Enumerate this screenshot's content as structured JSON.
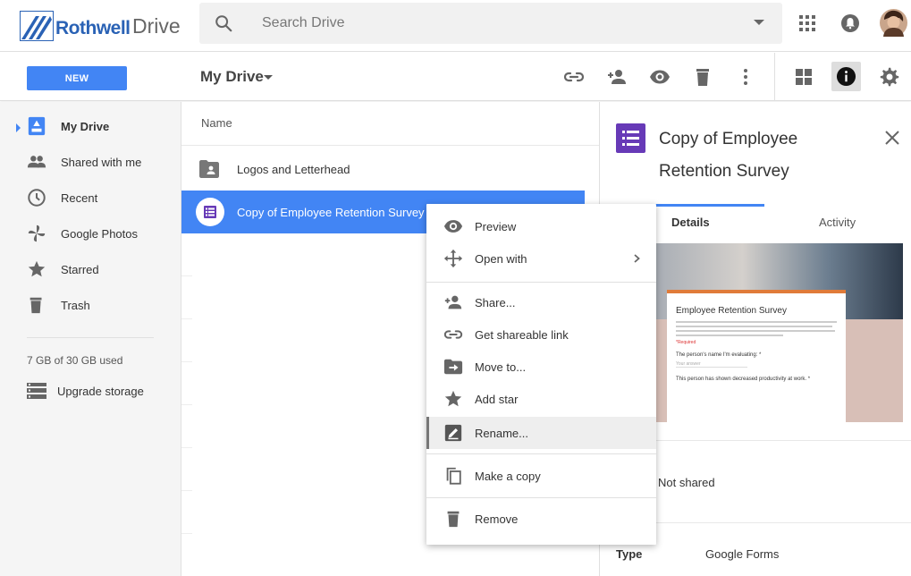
{
  "header": {
    "brand": "Rothwell",
    "product": "Drive",
    "search_placeholder": "Search Drive"
  },
  "toolbar": {
    "new_label": "NEW",
    "location": "My Drive"
  },
  "sidebar": {
    "items": [
      {
        "label": "My Drive",
        "icon": "drive-icon",
        "active": true
      },
      {
        "label": "Shared with me",
        "icon": "people-icon"
      },
      {
        "label": "Recent",
        "icon": "clock-icon"
      },
      {
        "label": "Google Photos",
        "icon": "pinwheel-icon"
      },
      {
        "label": "Starred",
        "icon": "star-icon"
      },
      {
        "label": "Trash",
        "icon": "trash-icon"
      }
    ],
    "storage": "7 GB of 30 GB used",
    "upgrade": "Upgrade storage"
  },
  "files": {
    "column_name": "Name",
    "rows": [
      {
        "name": "Logos and Letterhead",
        "icon": "shared-folder-icon"
      },
      {
        "name": "Copy of Employee Retention Survey",
        "icon": "forms-icon",
        "selected": true
      }
    ]
  },
  "context_menu": {
    "items": [
      {
        "label": "Preview",
        "icon": "eye-icon"
      },
      {
        "label": "Open with",
        "icon": "move-arrows-icon",
        "submenu": true
      },
      {
        "label": "Share...",
        "icon": "add-person-icon"
      },
      {
        "label": "Get shareable link",
        "icon": "link-icon"
      },
      {
        "label": "Move to...",
        "icon": "move-folder-icon"
      },
      {
        "label": "Add star",
        "icon": "star-icon"
      },
      {
        "label": "Rename...",
        "icon": "rename-icon",
        "hover": true
      },
      {
        "label": "Make a copy",
        "icon": "copy-icon"
      },
      {
        "label": "Remove",
        "icon": "trash-icon"
      }
    ]
  },
  "details": {
    "title": "Copy of Employee Retention Survey",
    "tabs": [
      "Details",
      "Activity"
    ],
    "preview": {
      "heading": "Employee Retention Survey",
      "required": "*Required",
      "q1": "The person's name I'm evaluating: *",
      "answer_placeholder": "Your answer",
      "q2": "This person has shown decreased productivity at work. *"
    },
    "sharing": "Not shared",
    "type_label": "Type",
    "type_value": "Google Forms"
  },
  "colors": {
    "accent": "#4285f4",
    "forms": "#673ab7",
    "sidebar_bg": "#f5f5f5"
  }
}
